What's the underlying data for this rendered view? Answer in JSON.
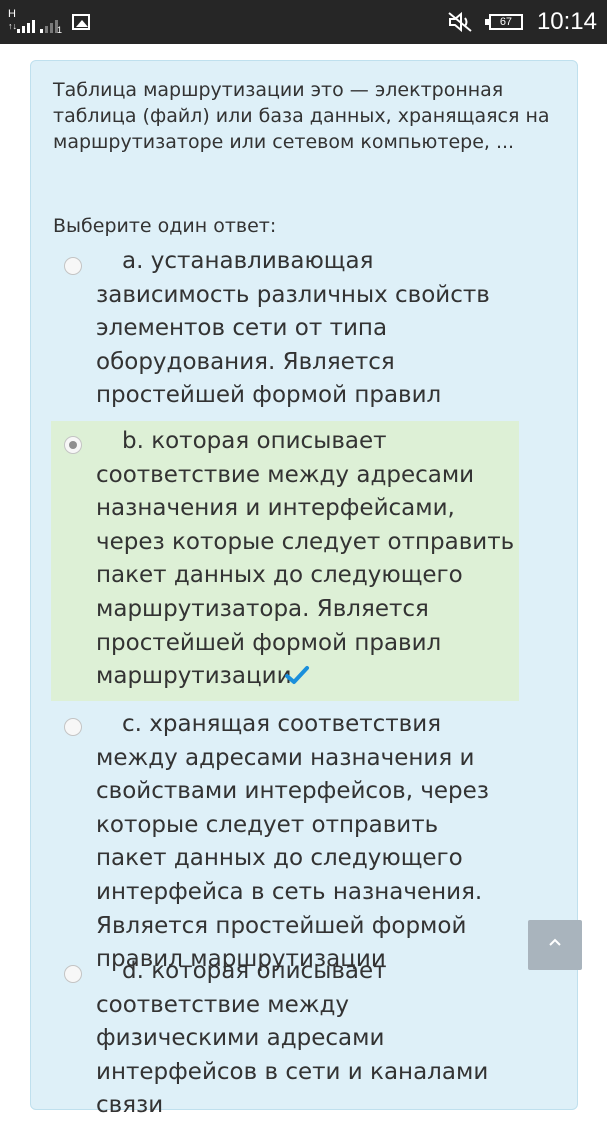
{
  "status_bar": {
    "network_type": "H",
    "arrows": "↑↓",
    "sim_sub": "1",
    "battery": "67",
    "time": "10:14",
    "icons": [
      "signal-icon",
      "signal-icon-sim2",
      "gallery-icon",
      "mute-icon",
      "battery-icon"
    ]
  },
  "quiz": {
    "question": "Таблица маршрутизации это — электронная таблица (файл) или база данных, хранящаяся на маршрутизаторе или сетевом компьютере, ...",
    "prompt": "Выберите один ответ:",
    "options": [
      {
        "text": "a. устанавливающая зависимость различных свойств элементов сети от типа оборудования. Является простейшей формой правил маршрутизации",
        "selected": false
      },
      {
        "text": "b. которая описывает соответствие между адресами назначения и интерфейсами, через которые следует отправить пакет данных до следующего маршрутизатора. Является простейшей формой правил маршрутизации",
        "selected": true,
        "correct": true
      },
      {
        "text": "c. хранящая соответствия между адресами назначения и свойствами интерфейсов, через которые следует отправить пакет данных до следующего интерфейса в сеть назначения. Является простейшей формой правил маршрутизации",
        "selected": false
      },
      {
        "text": "d. которая описывает соответствие между физическими адресами интерфейсов в сети и каналами связи",
        "selected": false
      }
    ]
  },
  "colors": {
    "card_background": "#def0f8",
    "selected_background": "#ddf0d6",
    "check_color": "#1a8fdb",
    "scroll_button": "#a9b4bd"
  }
}
